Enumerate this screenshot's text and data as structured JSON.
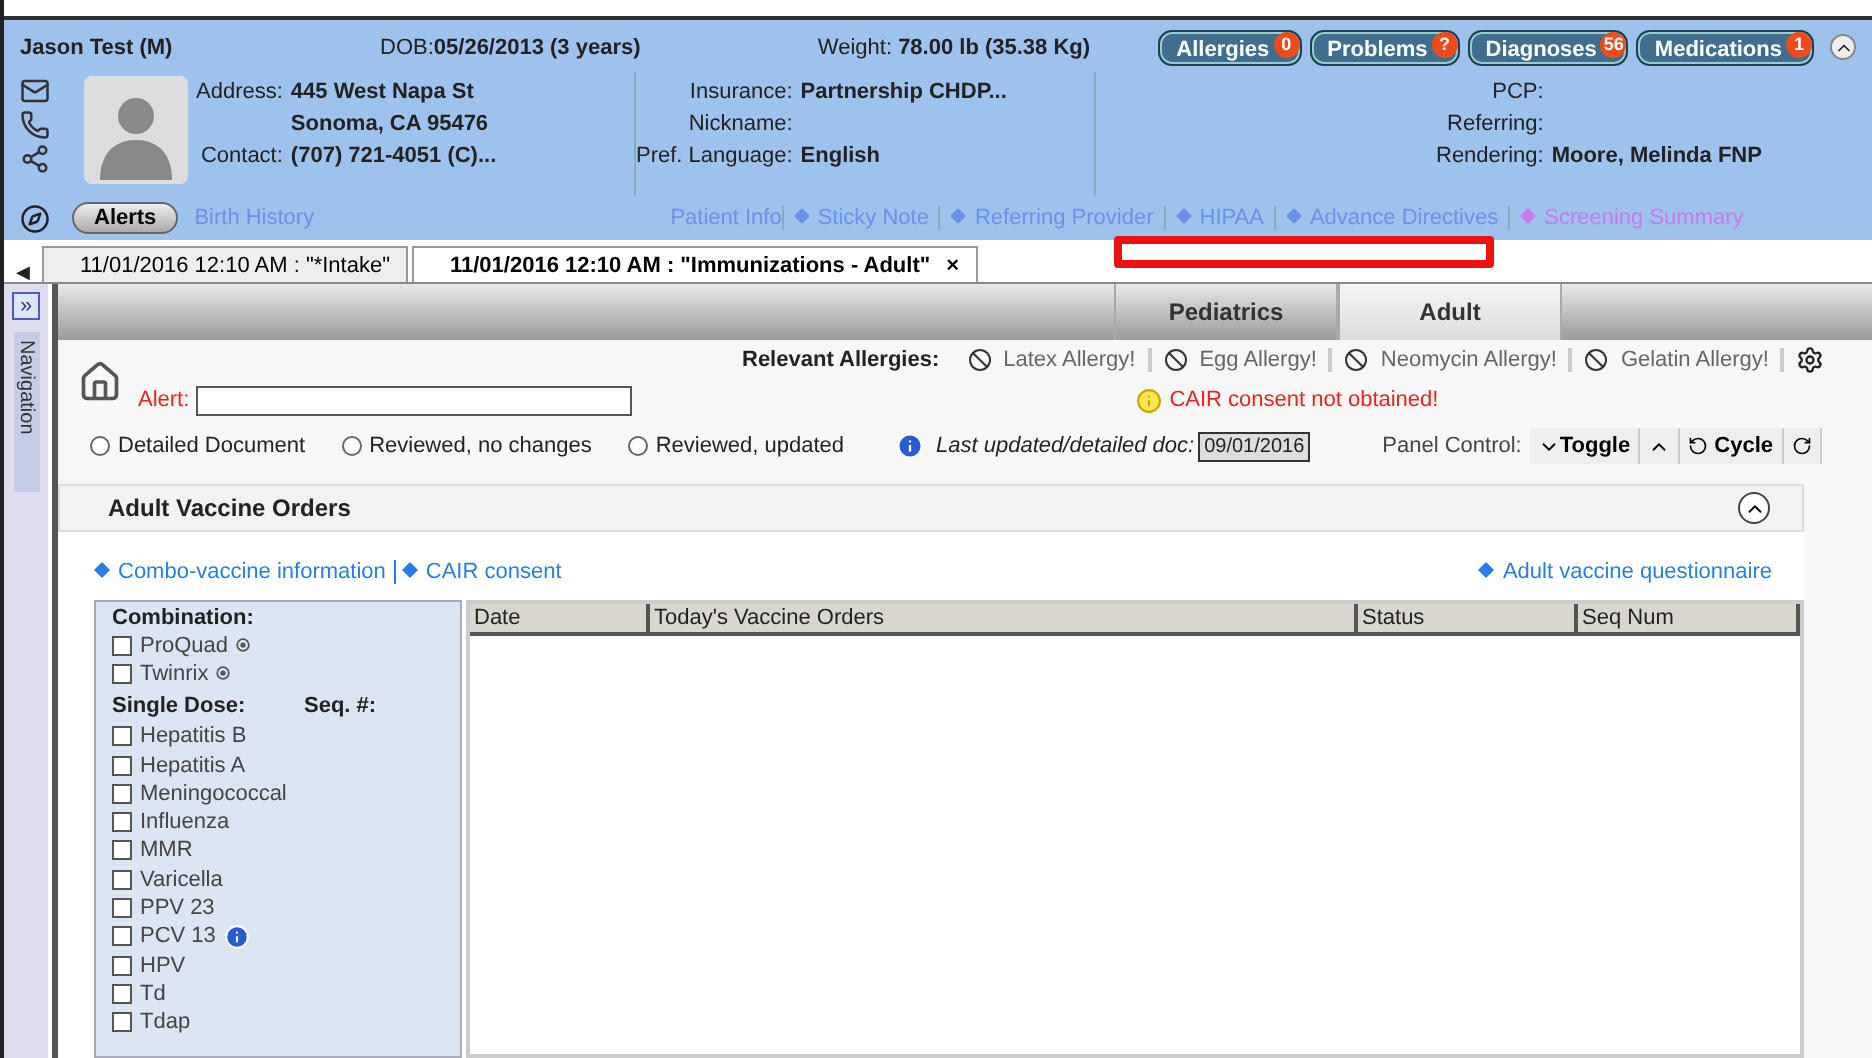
{
  "patient": {
    "name": "Jason Test  (M)",
    "dob_label": "DOB:",
    "dob": "05/26/2013 (3 years)",
    "weight_label": "Weight:",
    "weight": "78.00 lb (35.38 Kg)",
    "badges": [
      {
        "label": "Allergies",
        "count": "0"
      },
      {
        "label": "Problems",
        "count": "?"
      },
      {
        "label": "Diagnoses",
        "count": "56"
      },
      {
        "label": "Medications",
        "count": "1"
      }
    ],
    "col1": [
      {
        "label": "Address:",
        "value": "445 West Napa St"
      },
      {
        "value": "Sonoma, CA 95476"
      },
      {
        "label": "Contact:",
        "value": "(707) 721-4051 (C)..."
      }
    ],
    "col2": [
      {
        "label": "Insurance:",
        "value": "Partnership CHDP..."
      },
      {
        "label": "Nickname:"
      },
      {
        "label": "Pref. Language:",
        "value": "English"
      }
    ],
    "col3": [
      {
        "label": "PCP:"
      },
      {
        "label": "Referring:"
      },
      {
        "label": "Rendering:",
        "value": "Moore, Melinda FNP"
      }
    ],
    "alerts_button": "Alerts",
    "birth_history": "Birth History",
    "links": [
      {
        "label": "Patient Info",
        "kind": "plain"
      },
      {
        "label": "Sticky Note",
        "kind": "diamond"
      },
      {
        "label": "Referring Provider",
        "kind": "diamond"
      },
      {
        "label": "HIPAA",
        "kind": "diamond"
      },
      {
        "label": "Advance Directives",
        "kind": "diamond"
      },
      {
        "label": "Screening Summary",
        "kind": "highlight"
      }
    ]
  },
  "doc_tabs": [
    {
      "label": "11/01/2016 12:10 AM : \"*Intake\"",
      "selected": false
    },
    {
      "label": "11/01/2016 12:10 AM : \"Immunizations - Adult\"",
      "selected": true
    }
  ],
  "close_glyph": "×",
  "scroll_glyph": "◀",
  "navigation": {
    "label": "Navigation",
    "toggle": "»"
  },
  "form_tabs": [
    {
      "label": "Pediatrics",
      "selected": false
    },
    {
      "label": "Adult",
      "selected": true
    }
  ],
  "allergies_label": "Relevant Allergies:",
  "allergies": [
    "Latex Allergy!",
    "Egg Allergy!",
    "Neomycin Allergy!",
    "Gelatin Allergy!"
  ],
  "warning": "CAIR consent not obtained!",
  "alert_label": "Alert:",
  "radios": [
    {
      "label": "Detailed Document",
      "selected": false
    },
    {
      "label": "Reviewed, no changes",
      "selected": false
    },
    {
      "label": "Reviewed, updated",
      "selected": false
    }
  ],
  "last_updated_label": "Last updated/detailed doc:",
  "last_updated": "09/01/2016",
  "panel_control": {
    "label": "Panel Control:",
    "toggle": "Toggle",
    "cycle": "Cycle"
  },
  "section_title": "Adult Vaccine Orders",
  "section_expanded": true,
  "section_links": [
    "Combo-vaccine information",
    "CAIR consent"
  ],
  "questionnaire_link": "Adult vaccine questionnaire",
  "combination_label": "Combination:",
  "combination": [
    {
      "label": "ProQuad",
      "checked": false
    },
    {
      "label": "Twinrix",
      "checked": false
    }
  ],
  "single_label": "Single Dose:",
  "seq_label": "Seq. #:",
  "single": [
    {
      "label": "Hepatitis B",
      "checked": false,
      "info": false
    },
    {
      "label": "Hepatitis A",
      "checked": false,
      "info": false
    },
    {
      "label": "Meningococcal",
      "checked": false,
      "info": false
    },
    {
      "label": "Influenza",
      "checked": false,
      "info": false
    },
    {
      "label": "MMR",
      "checked": false,
      "info": false
    },
    {
      "label": "Varicella",
      "checked": false,
      "info": false
    },
    {
      "label": "PPV 23",
      "checked": false,
      "info": false
    },
    {
      "label": "PCV 13",
      "checked": false,
      "info": true
    },
    {
      "label": "HPV",
      "checked": false,
      "info": false
    },
    {
      "label": "Td",
      "checked": false,
      "info": false
    },
    {
      "label": "Tdap",
      "checked": false,
      "info": false
    }
  ],
  "table": {
    "columns": [
      "Date",
      "Today's Vaccine Orders",
      "Status",
      "Seq Num"
    ]
  }
}
